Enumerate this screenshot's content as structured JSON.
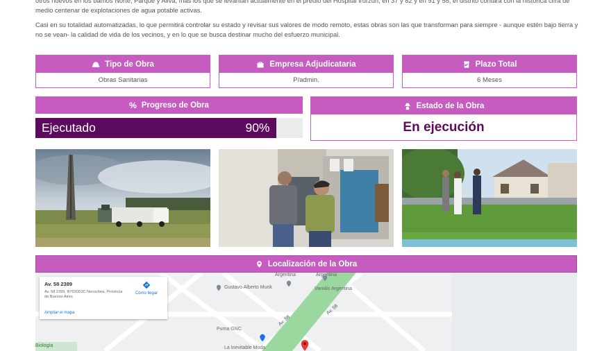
{
  "intro": {
    "paragraph1": "otros nuevos en los barrios Norte, Parque y Aliva, más los que se levantan actualmente en el predio del Hospital Irurzun, en 37 y 82 y en 91 y 58, el distrito contará con la histórica cifra de medio centenar de explotaciones de agua potable activas.",
    "paragraph2": "Casi en su totalidad automatizadas, lo que permitirá controlar su estado y revisar sus valores de modo remoto, estas obras son las que transforman para siempre - aunque estén bajo tierra y no se vean- la calidad de vida de los vecinos, y en lo que se busca destinar mucho del esfuerzo municipal."
  },
  "info_cards": [
    {
      "icon": "helmet-icon",
      "label": "Tipo de Obra",
      "value": "Obras Sanitarias"
    },
    {
      "icon": "briefcase-icon",
      "label": "Empresa Adjudicataria",
      "value": "P/admin."
    },
    {
      "icon": "calendar-check-icon",
      "label": "Plazo Total",
      "value": "6 Meses"
    }
  ],
  "progress": {
    "label": "Progreso de Obra",
    "icon": "percent-icon",
    "bar_text": "Ejecutado",
    "percent_text": "90%",
    "percent": 90,
    "fill_color": "#5c0a5e",
    "track_color": "#ececec"
  },
  "estado": {
    "label": "Estado de la Obra",
    "icon": "worker-icon",
    "value": "En ejecución"
  },
  "photos": [
    {
      "name": "drilling-rig-photo"
    },
    {
      "name": "electrical-panel-photo"
    },
    {
      "name": "officials-visit-photo"
    }
  ],
  "location": {
    "label": "Localización de la Obra",
    "icon": "map-pin-icon",
    "map": {
      "address_short": "Av. 58 2389",
      "address_full": "Av. 58 2399, B7630DJC Necochea, Provincia de Buenos Aires",
      "directions_label": "Cómo llegar",
      "enlarge_label": "Ampliar el mapa",
      "places": [
        "Argentina",
        "Gustavo Alberto Munk",
        "Argentina",
        "Vanidis Argentina",
        "Puma GNC",
        "La Inevitable Moda",
        "Biología"
      ],
      "roads": [
        "Av. 58",
        "Av. 58"
      ]
    }
  },
  "colors": {
    "accent": "#c65bc0",
    "dark_purple": "#5c0a5e"
  }
}
